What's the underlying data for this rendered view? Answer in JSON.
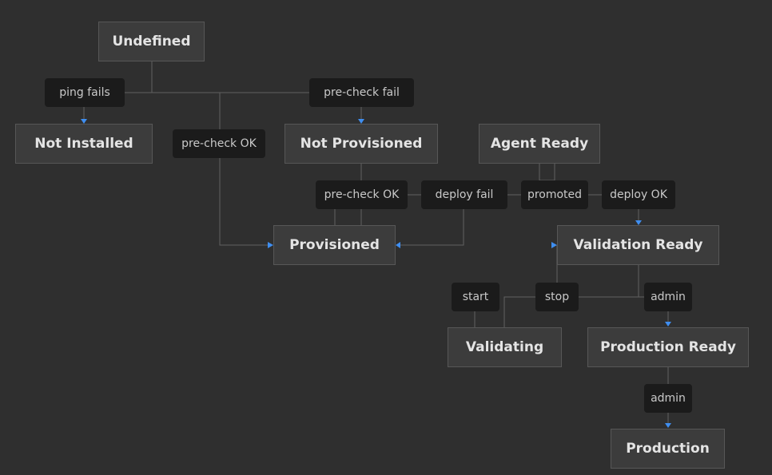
{
  "colors": {
    "background": "#2f2f2f",
    "node_fill": "#3c3c3c",
    "node_border": "#575757",
    "label_fill": "#1b1b1b",
    "edge": "#616161",
    "arrow": "#3f8ef0"
  },
  "states": {
    "undefined": "Undefined",
    "not_installed": "Not Installed",
    "not_provisioned": "Not Provisioned",
    "agent_ready": "Agent Ready",
    "provisioned": "Provisioned",
    "validation_ready": "Validation Ready",
    "validating": "Validating",
    "production_ready": "Production Ready",
    "production": "Production"
  },
  "transitions": {
    "ping_fails": "ping fails",
    "pre_check_fail": "pre-check fail",
    "pre_check_ok_1": "pre-check OK",
    "pre_check_ok_2": "pre-check OK",
    "deploy_fail": "deploy fail",
    "promoted": "promoted",
    "deploy_ok": "deploy OK",
    "start": "start",
    "stop": "stop",
    "admin_1": "admin",
    "admin_2": "admin"
  }
}
